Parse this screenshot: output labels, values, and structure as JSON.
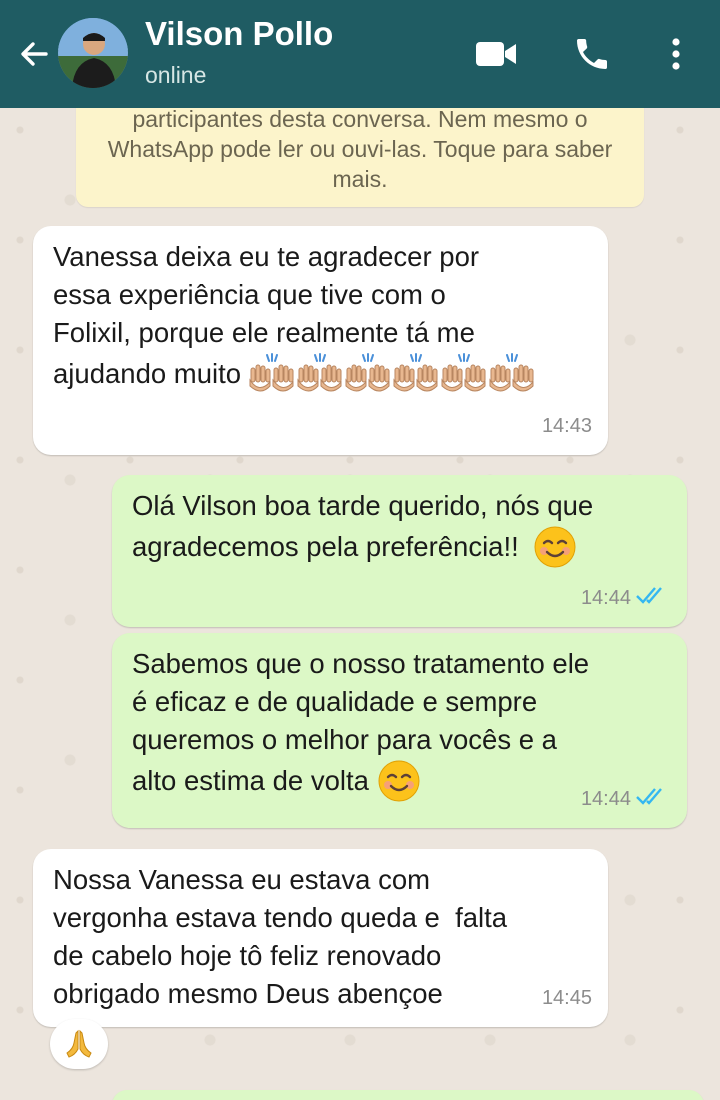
{
  "header": {
    "contact_name": "Vilson Pollo",
    "status": "online",
    "icons": [
      "back-arrow-icon",
      "video-call-icon",
      "phone-icon",
      "more-options-icon"
    ]
  },
  "encryption_banner": {
    "text": "participantes desta conversa. Nem mesmo o WhatsApp pode ler ou ouvi-las. Toque para saber mais."
  },
  "messages": [
    {
      "direction": "incoming",
      "lines": [
        "Vanessa deixa eu te agradecer por",
        "essa experiência que tive com o",
        "Folixil, porque ele realmente tá me",
        "ajudando muito"
      ],
      "emoji": "raising-hands-x6",
      "time": "14:43"
    },
    {
      "direction": "outgoing",
      "lines": [
        "Olá Vilson boa tarde querido, nós que",
        "agradecemos pela preferência!!"
      ],
      "emoji": "smiling-face",
      "time": "14:44",
      "status": "read"
    },
    {
      "direction": "outgoing",
      "lines": [
        "Sabemos que o nosso tratamento ele",
        "é eficaz e de qualidade e sempre",
        "queremos o melhor para vocês e a",
        "alto estima de volta"
      ],
      "emoji": "smiling-face",
      "time": "14:44",
      "status": "read"
    },
    {
      "direction": "incoming",
      "lines": [
        "Nossa Vanessa eu estava com",
        "vergonha estava tendo queda e  falta",
        "de cabelo hoje tô feliz renovado",
        "obrigado mesmo Deus abençoe"
      ],
      "time": "14:45",
      "reaction": "folded-hands"
    }
  ],
  "colors": {
    "header": "#1f5c63",
    "incoming_bubble": "#ffffff",
    "outgoing_bubble": "#dcf8c6",
    "read_ticks": "#34b7f1",
    "banner": "#fcf4cb"
  }
}
